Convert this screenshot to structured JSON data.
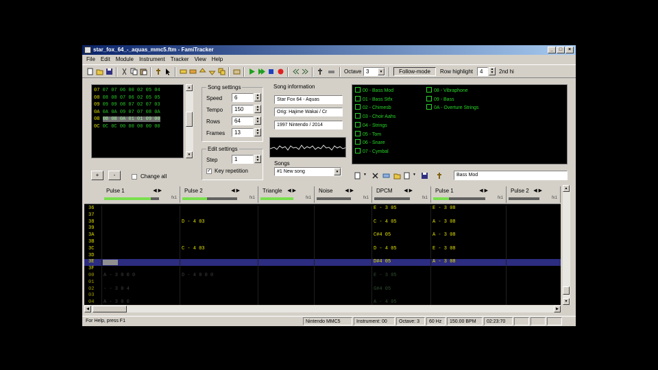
{
  "window": {
    "title": "star_fox_64_-_aquas_mmc5.ftm - FamiTracker"
  },
  "menu": [
    "File",
    "Edit",
    "Module",
    "Instrument",
    "Tracker",
    "View",
    "Help"
  ],
  "toolbar": {
    "octave_label": "Octave",
    "octave_value": "3",
    "follow_mode": "Follow-mode",
    "row_highlight_label": "Row highlight",
    "row_highlight_value": "4",
    "second_highlight": "2nd hi"
  },
  "frames": {
    "rows": [
      {
        "num": "07",
        "cells": "07 07 06 00 02 05 04"
      },
      {
        "num": "08",
        "cells": "08 08 07 06 02 05 05"
      },
      {
        "num": "09",
        "cells": "09 09 08 07 02 07 03"
      },
      {
        "num": "0A",
        "cells": "0A 0A 09 07 07 08 0A"
      },
      {
        "num": "0B",
        "cells": "0B 0B 0A 01 01 09 00",
        "current": true
      },
      {
        "num": "0C",
        "cells": "0C 0C 00 00 00 00 00"
      }
    ],
    "change_all": "Change all",
    "add": "+",
    "remove": "-"
  },
  "song_settings": {
    "title": "Song settings",
    "speed_label": "Speed",
    "speed": "6",
    "tempo_label": "Tempo",
    "tempo": "150",
    "rows_label": "Rows",
    "rows": "64",
    "frames_label": "Frames",
    "frames": "13"
  },
  "edit_settings": {
    "title": "Edit settings",
    "step_label": "Step",
    "step": "1",
    "key_repetition": "Key repetition"
  },
  "song_info": {
    "title": "Song information",
    "name": "Star Fox 64 - Aquas",
    "author": "Orig: Hajime Wakai / Cr",
    "copyright": "1997 Nintendo / 2014"
  },
  "songs": {
    "title": "Songs",
    "selected": "#1 New song"
  },
  "instruments": [
    "00 - Bass Mod",
    "01 - Bass Stfx",
    "02 - Chimesb",
    "03 - Choir Aahs",
    "04 - Strings",
    "05 - Tom",
    "06 - Snare",
    "07 - Cymbal",
    "08 - Vibraphone",
    "09 - Bass",
    "0A - Overture Strings"
  ],
  "instrument_name": "Bass Mod",
  "channels": [
    {
      "name": "Pulse 1",
      "vol": 0.85
    },
    {
      "name": "Pulse 2",
      "vol": 0.45
    },
    {
      "name": "Triangle",
      "vol": 1.0
    },
    {
      "name": "Noise",
      "vol": 0.0
    },
    {
      "name": "DPCM",
      "vol": 0.0
    },
    {
      "name": "Pulse 1",
      "vol": 0.3
    },
    {
      "name": "Pulse 2",
      "vol": 0.0
    }
  ],
  "pattern_rows": [
    {
      "num": "36",
      "cells": [
        "",
        "",
        "",
        "",
        "E - 3  05",
        "E - 3  08",
        ""
      ]
    },
    {
      "num": "37",
      "cells": [
        "",
        "",
        "",
        "",
        "",
        "",
        ""
      ]
    },
    {
      "num": "38",
      "cells": [
        "",
        "D - 4  03",
        "",
        "",
        "C - 4  05",
        "A - 3  08",
        ""
      ]
    },
    {
      "num": "39",
      "cells": [
        "",
        "",
        "",
        "",
        "",
        "",
        ""
      ]
    },
    {
      "num": "3A",
      "cells": [
        "",
        "",
        "",
        "",
        "C#4  05",
        "A - 3  08",
        ""
      ]
    },
    {
      "num": "3B",
      "cells": [
        "",
        "",
        "",
        "",
        "",
        "",
        ""
      ]
    },
    {
      "num": "3C",
      "cells": [
        "",
        "C - 4  03",
        "",
        "",
        "D - 4  05",
        "E - 3  08",
        ""
      ]
    },
    {
      "num": "3D",
      "cells": [
        "",
        "",
        "",
        "",
        "",
        "",
        ""
      ]
    },
    {
      "num": "3E",
      "cells": [
        "",
        "",
        "",
        "",
        "D#4  05",
        "A - 3  08",
        ""
      ],
      "current": true
    },
    {
      "num": "3F",
      "cells": [
        "",
        "",
        "",
        "",
        "",
        "",
        ""
      ]
    },
    {
      "num": "00",
      "cells": [
        "A - 3  0 0  0",
        "D - 4  0 0  0",
        "",
        "",
        "E - 3  05",
        "",
        ""
      ],
      "dim": true
    },
    {
      "num": "01",
      "cells": [
        "",
        "",
        "",
        "",
        "",
        "",
        ""
      ],
      "dim": true
    },
    {
      "num": "02",
      "cells": [
        "- - 3  0 4",
        "",
        "",
        "",
        "G#4  05",
        "",
        ""
      ],
      "dim": true
    },
    {
      "num": "03",
      "cells": [
        "",
        "",
        "",
        "",
        "",
        "",
        ""
      ],
      "dim": true
    },
    {
      "num": "04",
      "cells": [
        "A - 3  0 0",
        "",
        "",
        "",
        "A - 4  05",
        "",
        ""
      ],
      "dim": true
    }
  ],
  "status": {
    "help": "For Help, press F1",
    "chip": "Nintendo MMC5",
    "instrument": "Instrument: 00",
    "octave": "Octave: 3",
    "rate": "60 Hz",
    "bpm": "150.00 BPM",
    "time": "02:23:70"
  }
}
